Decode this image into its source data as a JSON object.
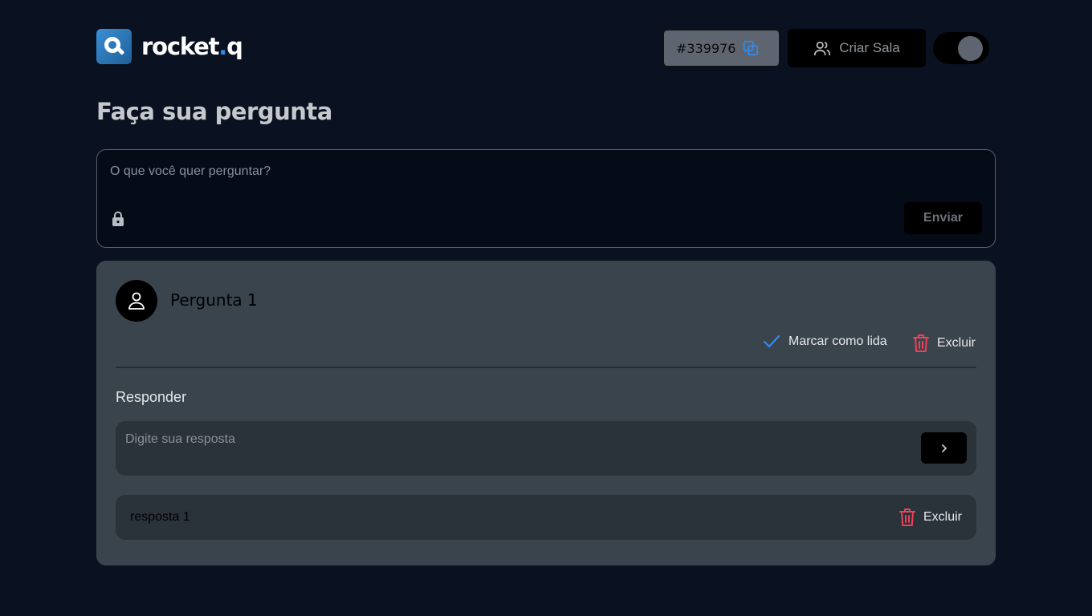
{
  "header": {
    "logo_text": "rocket",
    "logo_dot": ".",
    "logo_suffix": "q",
    "room_code": "#339976",
    "create_room_label": "Criar Sala"
  },
  "page": {
    "title": "Faça sua pergunta"
  },
  "ask": {
    "placeholder": "O que você quer perguntar?",
    "send_label": "Enviar"
  },
  "question": {
    "title": "Pergunta 1",
    "mark_read_label": "Marcar como lida",
    "delete_label": "Excluir",
    "reply_label": "Responder",
    "reply_placeholder": "Digite sua resposta",
    "answers": [
      {
        "text": "resposta 1",
        "delete_label": "Excluir"
      }
    ]
  },
  "colors": {
    "background": "#0a1120",
    "card": "#3a444d",
    "accent": "#2f8cf0",
    "danger": "#f0405a"
  }
}
